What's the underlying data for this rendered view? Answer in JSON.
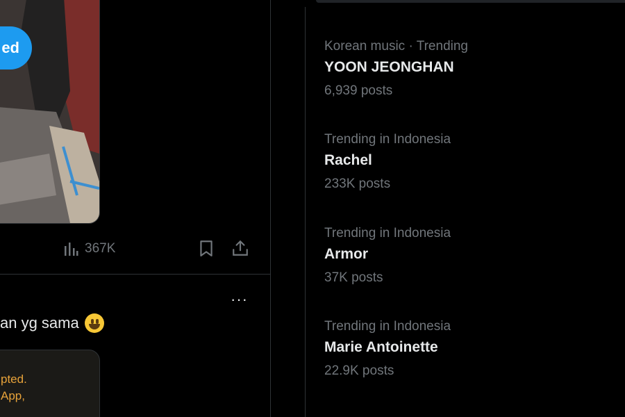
{
  "feed": {
    "follow_label": "ed",
    "views_count": "367K",
    "tweet_text": "an yg sama",
    "card_lines": [
      "pted.",
      "App,"
    ],
    "more_label": "···"
  },
  "trends": [
    {
      "context": "Korean music · Trending",
      "topic": "YOON JEONGHAN",
      "count": "6,939 posts"
    },
    {
      "context": "Trending in Indonesia",
      "topic": "Rachel",
      "count": "233K posts"
    },
    {
      "context": "Trending in Indonesia",
      "topic": "Armor",
      "count": "37K posts"
    },
    {
      "context": "Trending in Indonesia",
      "topic": "Marie Antoinette",
      "count": "22.9K posts"
    }
  ],
  "colors": {
    "accent": "#1d9bf0",
    "background": "#000000",
    "muted": "#71767b",
    "text": "#e7e9ea",
    "border": "#2f3336"
  },
  "icons": [
    "views-icon",
    "bookmark-icon",
    "share-icon",
    "more-icon",
    "smiley-emoji"
  ]
}
